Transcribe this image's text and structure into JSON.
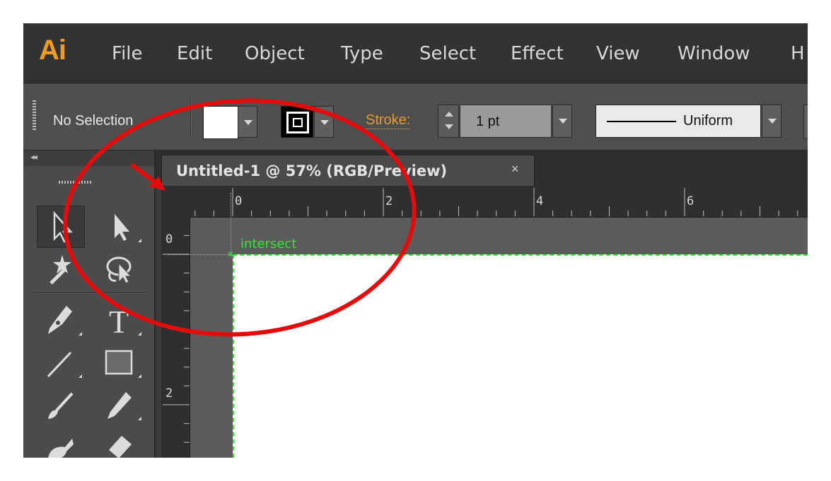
{
  "app": {
    "logo": "Ai"
  },
  "menu": [
    "File",
    "Edit",
    "Object",
    "Type",
    "Select",
    "Effect",
    "View",
    "Window",
    "H"
  ],
  "control_bar": {
    "selection_status": "No Selection",
    "stroke_label": "Stroke:",
    "stroke_weight": "1 pt",
    "variable_width": "Uniform"
  },
  "document": {
    "tab_title": "Untitled-1 @ 57% (RGB/Preview)",
    "close_glyph": "×",
    "h_ruler_labels": [
      "0",
      "2",
      "4",
      "6"
    ],
    "v_ruler_labels": [
      "0",
      "2"
    ],
    "smart_guide_label": "intersect"
  },
  "colors": {
    "logo": "#ef9a22",
    "stroke_label": "#e89a2e",
    "smart_guide": "#39e339",
    "annotation": "#e30b0b"
  },
  "icons": [
    "selection-tool-icon",
    "direct-selection-tool-icon",
    "magic-wand-tool-icon",
    "lasso-tool-icon",
    "pen-tool-icon",
    "type-tool-icon",
    "line-segment-tool-icon",
    "rectangle-tool-icon",
    "paintbrush-tool-icon",
    "pencil-tool-icon",
    "blob-brush-tool-icon",
    "eraser-tool-icon"
  ]
}
